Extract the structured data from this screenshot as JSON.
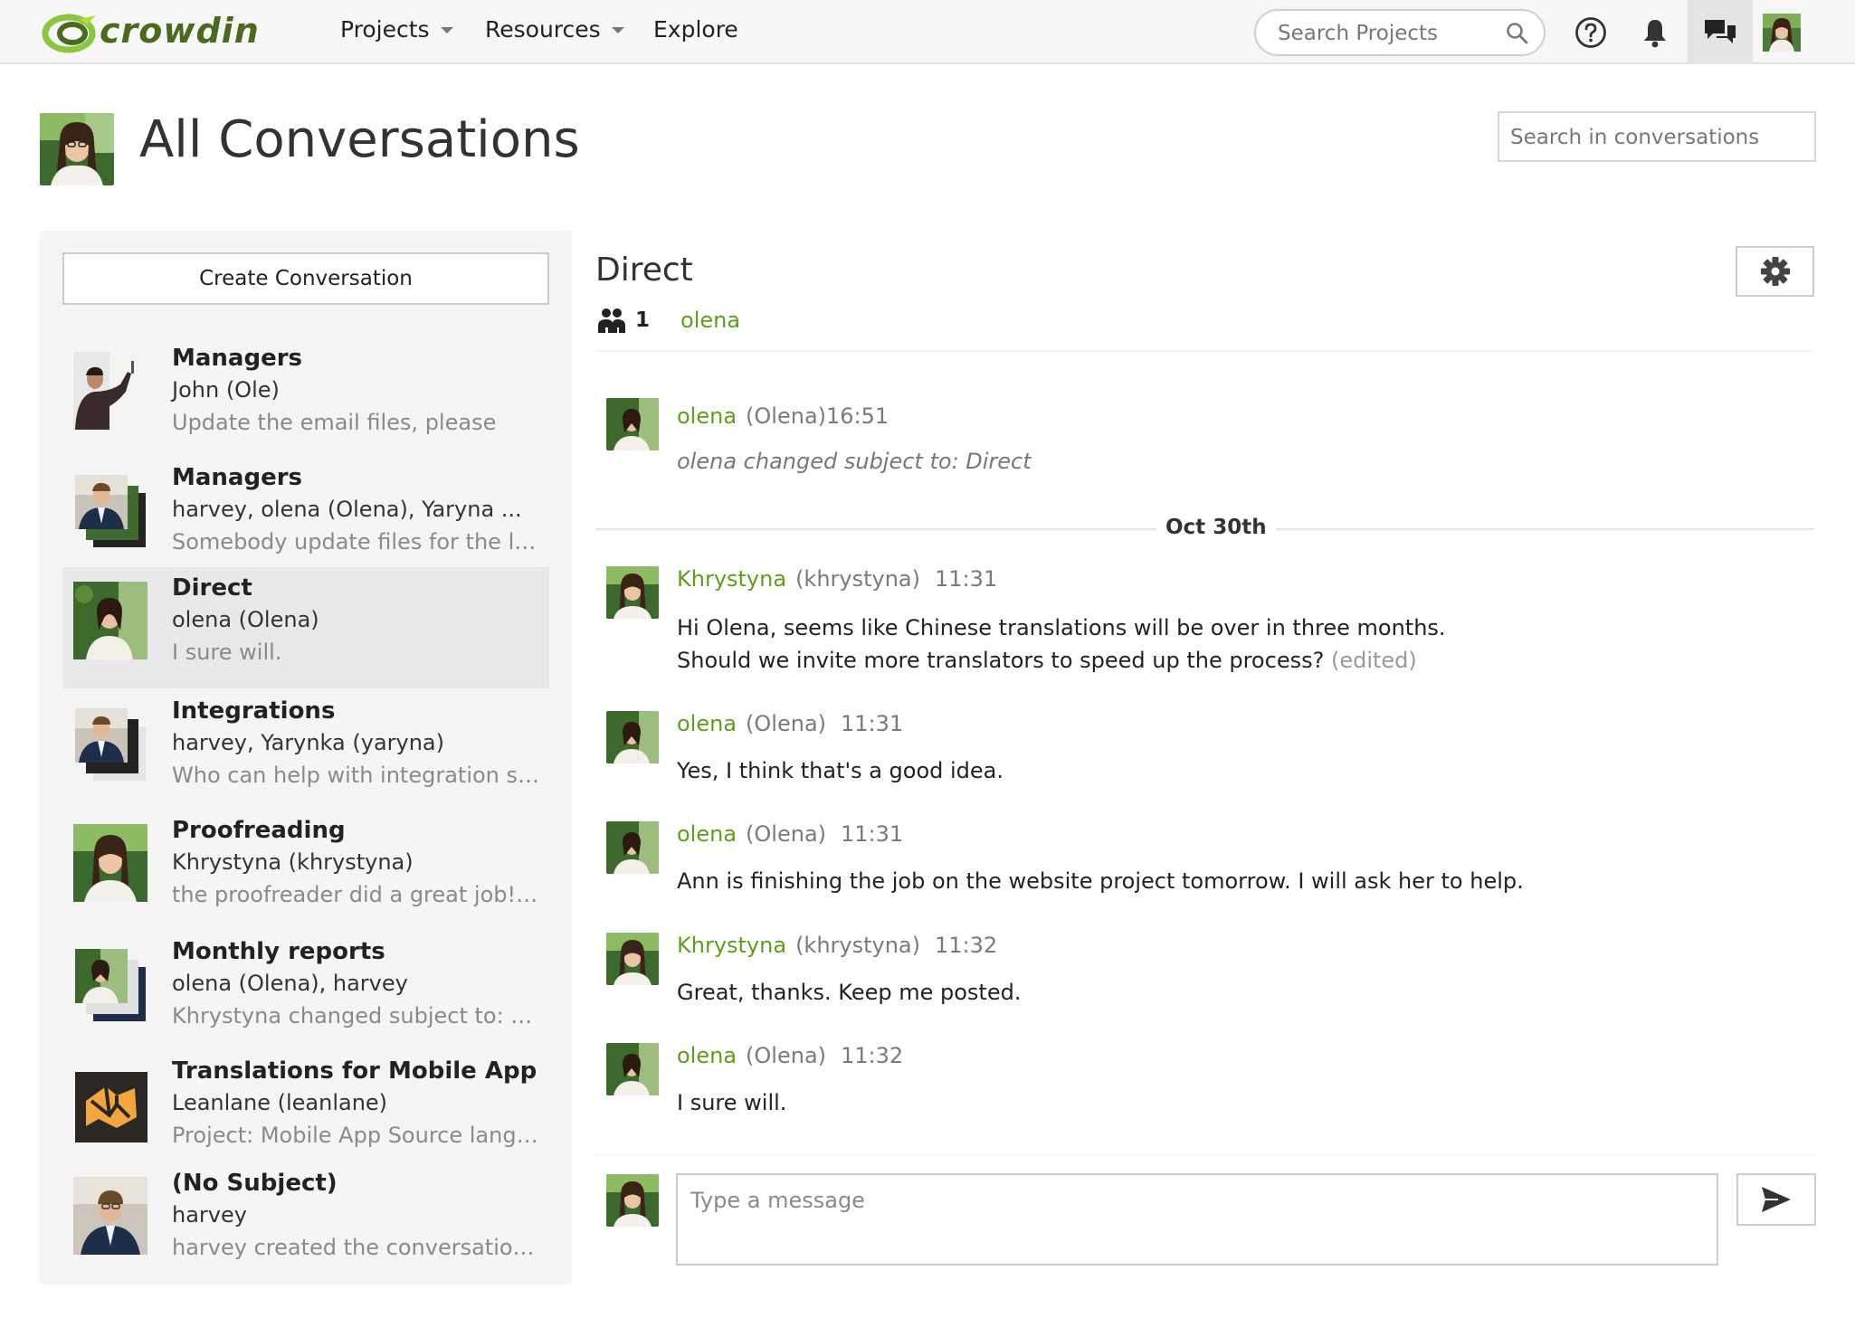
{
  "nav": {
    "logo_text": "crowdin",
    "items": [
      {
        "label": "Projects",
        "has_caret": true
      },
      {
        "label": "Resources",
        "has_caret": true
      },
      {
        "label": "Explore",
        "has_caret": false
      }
    ],
    "search_placeholder": "Search Projects",
    "icons": [
      "help-icon",
      "bell-icon",
      "chat-icon",
      "user-avatar"
    ]
  },
  "page": {
    "title": "All Conversations",
    "search_placeholder": "Search in conversations"
  },
  "sidebar": {
    "create_label": "Create Conversation",
    "conversations": [
      {
        "subject": "Managers",
        "members": "John (Ole)",
        "preview": "Update the email files, please",
        "active": false
      },
      {
        "subject": "Managers",
        "members": "harvey, olena (Olena), Yaryna ...",
        "preview": "Somebody update files for the logi...",
        "active": false
      },
      {
        "subject": "Direct",
        "members": "olena (Olena)",
        "preview": "I sure will.",
        "active": true
      },
      {
        "subject": "Integrations",
        "members": "harvey, Yarynka (yaryna)",
        "preview": "Who can help with integration set ...",
        "active": false
      },
      {
        "subject": "Proofreading",
        "members": "Khrystyna (khrystyna)",
        "preview": "the proofreader did a great job! w...",
        "active": false
      },
      {
        "subject": "Monthly reports",
        "members": "olena (Olena), harvey",
        "preview": "Khrystyna changed subject to: Mo...",
        "active": false
      },
      {
        "subject": "Translations for Mobile App",
        "members": "Leanlane (leanlane)",
        "preview": "Project: Mobile App Source langua...",
        "active": false
      },
      {
        "subject": "(No Subject)",
        "members": "harvey",
        "preview": "harvey created the conversation a...",
        "active": false
      }
    ]
  },
  "chat": {
    "title": "Direct",
    "member_count": "1",
    "member_name": "olena",
    "date_divider": "Oct 30th",
    "messages": [
      {
        "user": "olena",
        "login": "(Olena)",
        "time": "16:51",
        "lines": [
          "olena changed subject to: Direct"
        ],
        "system": true
      },
      {
        "user": "Khrystyna",
        "login": "(khrystyna)",
        "time": "11:31",
        "lines": [
          "Hi Olena, seems like Chinese translations will be over in three months.",
          "Should we invite more translators to speed up the process?"
        ],
        "edited": "(edited)"
      },
      {
        "user": "olena",
        "login": "(Olena)",
        "time": "11:31",
        "lines": [
          "Yes, I think that's a good idea."
        ]
      },
      {
        "user": "olena",
        "login": "(Olena)",
        "time": "11:31",
        "lines": [
          "Ann is finishing the job on the website project tomorrow. I will ask her to help."
        ]
      },
      {
        "user": "Khrystyna",
        "login": "(khrystyna)",
        "time": "11:32",
        "lines": [
          "Great, thanks. Keep me posted."
        ]
      },
      {
        "user": "olena",
        "login": "(Olena)",
        "time": "11:32",
        "lines": [
          "I sure will."
        ]
      }
    ],
    "composer_placeholder": "Type a message"
  },
  "colors": {
    "accent_green": "#5f9e1a",
    "logo_green": "#4a6b1e"
  }
}
